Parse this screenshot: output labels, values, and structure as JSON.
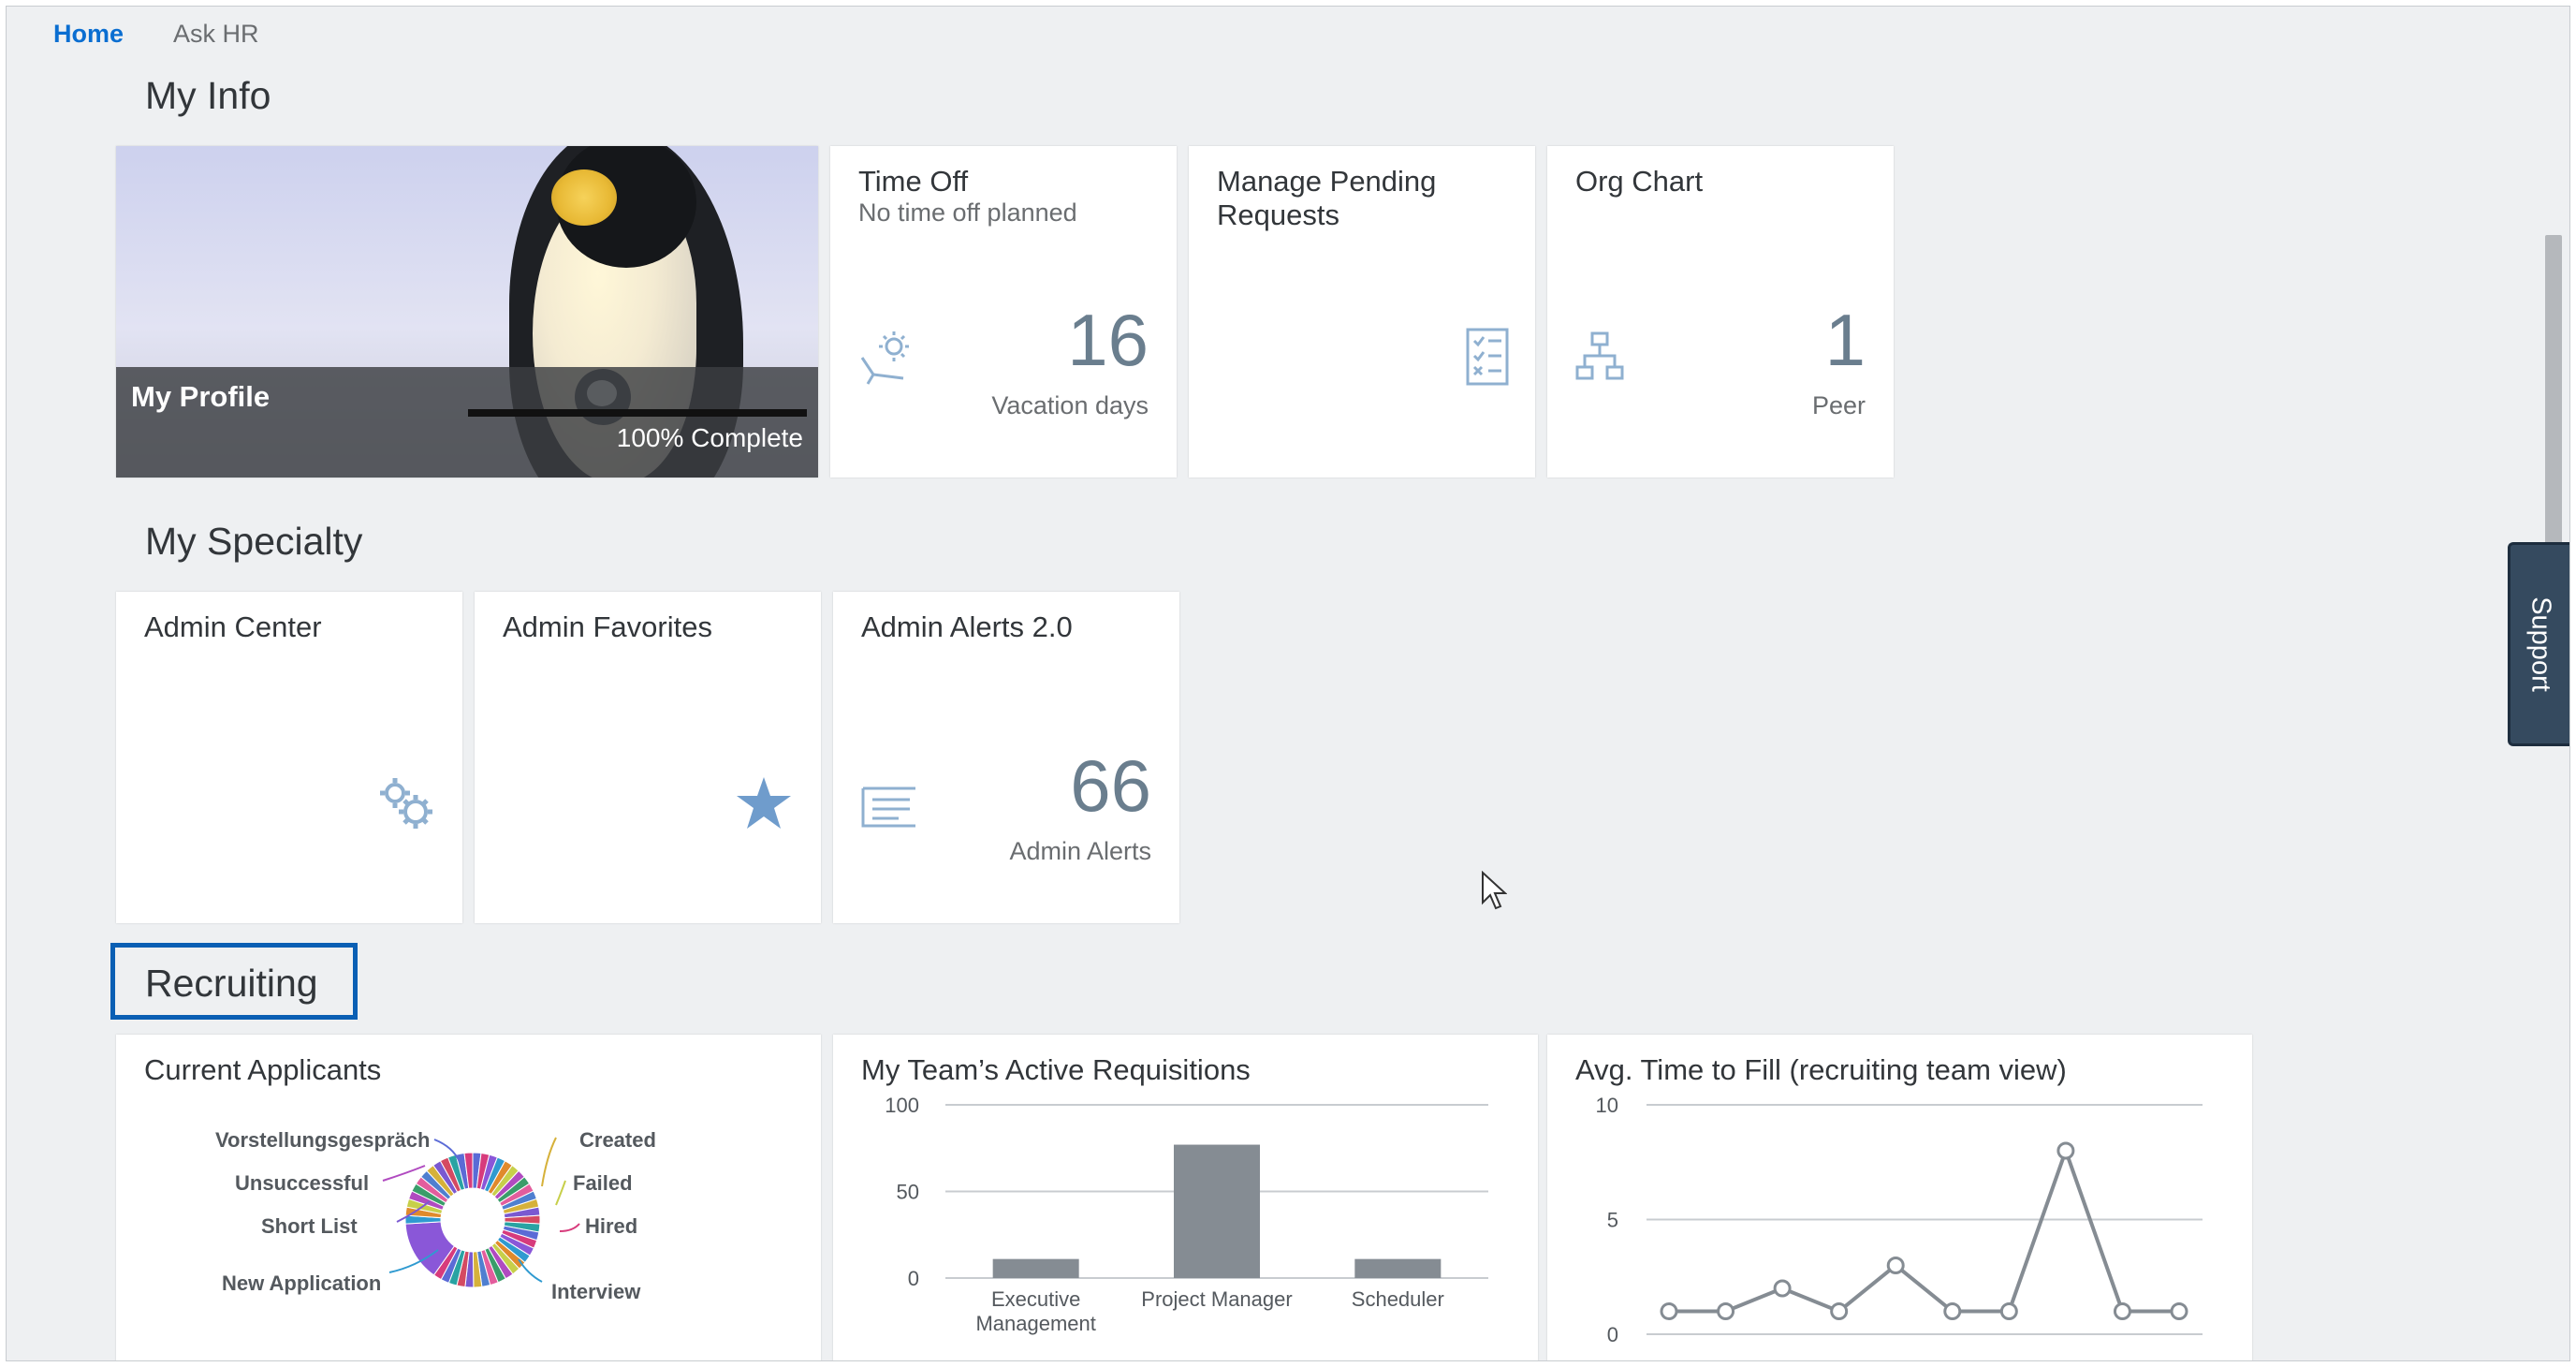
{
  "nav": {
    "tabs": [
      {
        "label": "Home",
        "active": true
      },
      {
        "label": "Ask HR",
        "active": false
      }
    ]
  },
  "sections": {
    "my_info": "My Info",
    "my_specialty": "My Specialty",
    "recruiting": "Recruiting"
  },
  "profile": {
    "title": "My Profile",
    "progress_percent": 100,
    "progress_label": "100% Complete"
  },
  "tiles": {
    "time_off": {
      "title": "Time Off",
      "subtitle": "No time off planned",
      "value": "16",
      "unit": "Vacation days",
      "icon": "vacation-icon"
    },
    "pending": {
      "title": "Manage Pending Requests",
      "icon": "checklist-icon"
    },
    "org_chart": {
      "title": "Org Chart",
      "value": "1",
      "unit": "Peer",
      "icon": "org-chart-icon"
    },
    "admin_center": {
      "title": "Admin Center",
      "icon": "gears-icon"
    },
    "admin_favorites": {
      "title": "Admin Favorites",
      "icon": "star-icon"
    },
    "admin_alerts": {
      "title": "Admin Alerts 2.0",
      "value": "66",
      "unit": "Admin Alerts",
      "icon": "list-icon"
    }
  },
  "support_label": "Support",
  "colors": {
    "accent": "#0a6ed1",
    "kpi": "#6a7e8e",
    "bar": "#858c93",
    "icon": "#8fb0d0",
    "support_bg": "#354a5f"
  },
  "chart_data": [
    {
      "type": "pie",
      "title": "Current Applicants",
      "labels": [
        "Vorstellungsgespräch",
        "Unsuccessful",
        "Short List",
        "New Application",
        "Created",
        "Failed",
        "Hired",
        "Interview"
      ]
    },
    {
      "type": "bar",
      "title": "My Team’s Active Requisitions",
      "categories": [
        "Executive Management",
        "Project Manager",
        "Scheduler"
      ],
      "values": [
        11,
        77,
        11
      ],
      "ylim": [
        0,
        100
      ],
      "yticks": [
        "0",
        "50",
        "100"
      ]
    },
    {
      "type": "line",
      "title": "Avg. Time to Fill (recruiting team view)",
      "values": [
        1,
        1,
        2,
        1,
        3,
        1,
        1,
        8,
        1,
        1
      ],
      "ylim": [
        0,
        10
      ],
      "yticks": [
        "0",
        "5",
        "10"
      ]
    }
  ]
}
